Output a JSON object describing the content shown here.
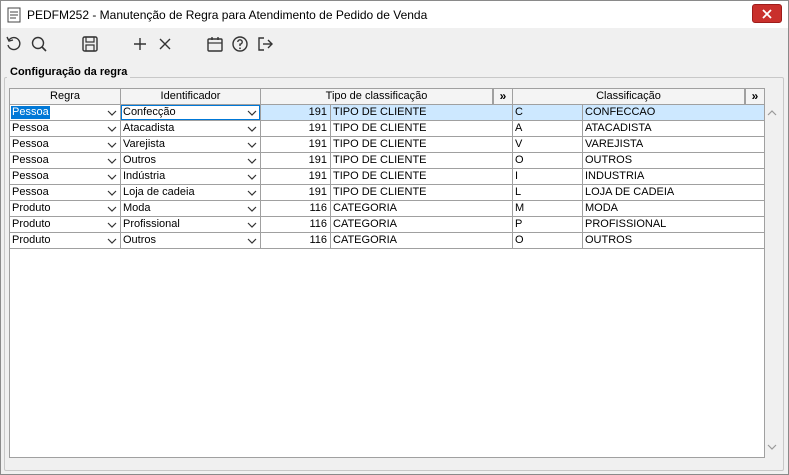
{
  "window": {
    "title": "PEDFM252 - Manutenção de Regra para Atendimento de Pedido de Venda"
  },
  "toolbar": {
    "icons": [
      "refresh-icon",
      "search-icon",
      "save-icon",
      "add-icon",
      "delete-icon",
      "calendar-icon",
      "help-icon",
      "exit-icon"
    ]
  },
  "group": {
    "label": "Configuração da regra"
  },
  "grid": {
    "headers": {
      "regra": "Regra",
      "identificador": "Identificador",
      "tipo": "Tipo de classificação",
      "classificacao": "Classificação",
      "expand": "»"
    },
    "rows": [
      {
        "regra": "Pessoa",
        "identificador": "Confecção",
        "codigo": "191",
        "tipo": "TIPO DE CLIENTE",
        "cod_class": "C",
        "classificacao": "CONFECCAO"
      },
      {
        "regra": "Pessoa",
        "identificador": "Atacadista",
        "codigo": "191",
        "tipo": "TIPO DE CLIENTE",
        "cod_class": "A",
        "classificacao": "ATACADISTA"
      },
      {
        "regra": "Pessoa",
        "identificador": "Varejista",
        "codigo": "191",
        "tipo": "TIPO DE CLIENTE",
        "cod_class": "V",
        "classificacao": "VAREJISTA"
      },
      {
        "regra": "Pessoa",
        "identificador": "Outros",
        "codigo": "191",
        "tipo": "TIPO DE CLIENTE",
        "cod_class": "O",
        "classificacao": "OUTROS"
      },
      {
        "regra": "Pessoa",
        "identificador": "Indústria",
        "codigo": "191",
        "tipo": "TIPO DE CLIENTE",
        "cod_class": "I",
        "classificacao": "INDUSTRIA"
      },
      {
        "regra": "Pessoa",
        "identificador": "Loja de cadeia",
        "codigo": "191",
        "tipo": "TIPO DE CLIENTE",
        "cod_class": "L",
        "classificacao": "LOJA DE CADEIA"
      },
      {
        "regra": "Produto",
        "identificador": "Moda",
        "codigo": "116",
        "tipo": "CATEGORIA",
        "cod_class": "M",
        "classificacao": "MODA"
      },
      {
        "regra": "Produto",
        "identificador": "Profissional",
        "codigo": "116",
        "tipo": "CATEGORIA",
        "cod_class": "P",
        "classificacao": "PROFISSIONAL"
      },
      {
        "regra": "Produto",
        "identificador": "Outros",
        "codigo": "116",
        "tipo": "CATEGORIA",
        "cod_class": "O",
        "classificacao": "OUTROS"
      }
    ]
  },
  "colors": {
    "selection": "#0078d7",
    "selected_row": "#cde8ff",
    "close_button": "#c9302c"
  }
}
